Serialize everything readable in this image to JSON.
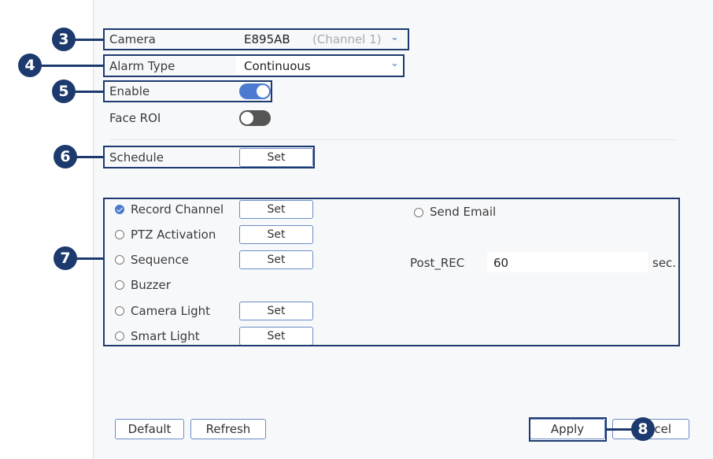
{
  "camera": {
    "label": "Camera",
    "value": "E895AB",
    "channel": "(Channel 1)"
  },
  "alarm_type": {
    "label": "Alarm Type",
    "value": "Continuous"
  },
  "enable": {
    "label": "Enable",
    "state": "on"
  },
  "face_roi": {
    "label": "Face ROI",
    "state": "off"
  },
  "schedule": {
    "label": "Schedule",
    "button": "Set"
  },
  "actions": {
    "record_channel": {
      "label": "Record Channel",
      "button": "Set",
      "checked": true
    },
    "ptz_activation": {
      "label": "PTZ Activation",
      "button": "Set",
      "checked": false
    },
    "sequence": {
      "label": "Sequence",
      "button": "Set",
      "checked": false
    },
    "buzzer": {
      "label": "Buzzer",
      "checked": false
    },
    "camera_light": {
      "label": "Camera Light",
      "button": "Set",
      "checked": false
    },
    "smart_light": {
      "label": "Smart Light",
      "button": "Set",
      "checked": false
    },
    "send_email": {
      "label": "Send Email",
      "checked": false
    },
    "post_rec": {
      "label": "Post_REC",
      "value": "60",
      "unit": "sec."
    }
  },
  "footer": {
    "default": "Default",
    "refresh": "Refresh",
    "apply": "Apply",
    "cancel_partial": "cel"
  },
  "callouts": {
    "c3": "3",
    "c4": "4",
    "c5": "5",
    "c6": "6",
    "c7": "7",
    "c8": "8"
  },
  "colors": {
    "accent": "#4a7bd0",
    "callout": "#1d3a6e"
  }
}
